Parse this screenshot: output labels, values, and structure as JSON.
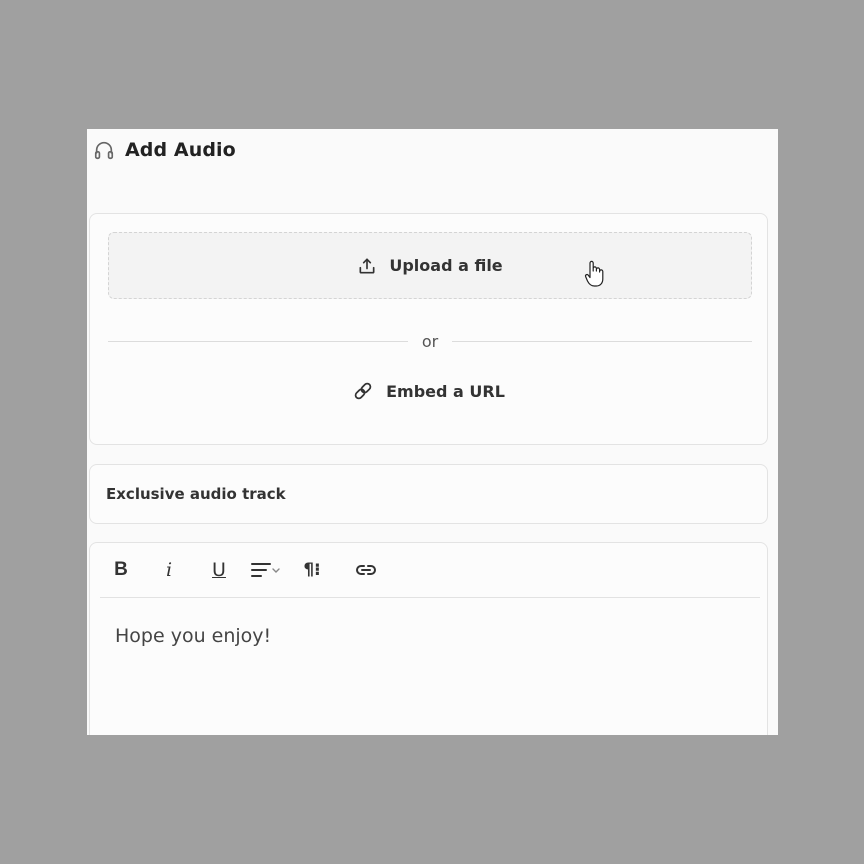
{
  "header": {
    "title": "Add Audio",
    "icon": "headphones-icon"
  },
  "upload": {
    "label": "Upload a file",
    "icon": "upload-icon"
  },
  "divider": {
    "text": "or"
  },
  "embed": {
    "label": "Embed a URL",
    "icon": "link-icon"
  },
  "title_field": {
    "value": "Exclusive audio track"
  },
  "editor": {
    "toolbar": {
      "bold": "B",
      "italic": "i",
      "underline": "U",
      "paragraph": "¶⁝"
    },
    "body": "Hope you enjoy!"
  },
  "colors": {
    "backdrop": "#a0a0a0",
    "card": "#fafafa",
    "border": "#e3e3e3",
    "text": "#333333"
  }
}
